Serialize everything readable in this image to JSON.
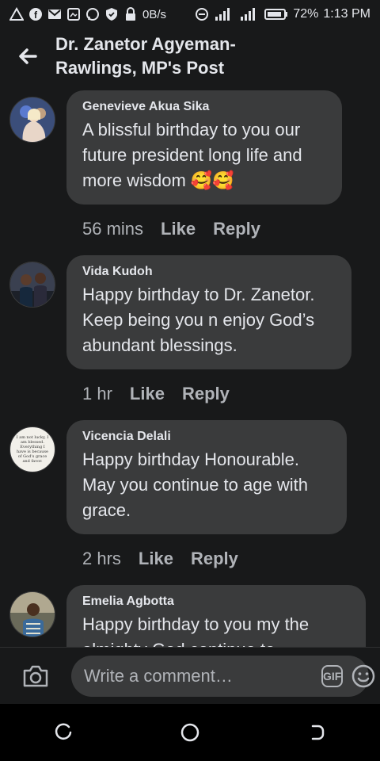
{
  "status_bar": {
    "data_speed": "0B/s",
    "battery": "72%",
    "time": "1:13 PM"
  },
  "header": {
    "title": "Dr. Zanetor Agyeman-Rawlings, MP's Post"
  },
  "comments": [
    {
      "author": "Genevieve Akua Sika",
      "text": "A blissful birthday to you our future president long life and more wisdom 🥰🥰",
      "time": "56 mins",
      "like": "Like",
      "reply": "Reply"
    },
    {
      "author": "Vida Kudoh",
      "text": "Happy birthday to Dr. Zanetor. Keep being you n enjoy God’s abundant blessings.",
      "time": "1 hr",
      "like": "Like",
      "reply": "Reply"
    },
    {
      "author": "Vicencia Delali",
      "text": "Happy birthday Honourable. May you continue to age with grace.",
      "time": "2 hrs",
      "like": "Like",
      "reply": "Reply",
      "avatar_text": "I am not lucky, I am blessed. Everything I have is because of God's grace and favor."
    },
    {
      "author": "Emelia Agbotta",
      "text": "Happy birthday to you my the almighty God continue to",
      "time": "",
      "like": "",
      "reply": ""
    }
  ],
  "composer": {
    "placeholder": "Write a comment…",
    "gif_label": "GIF"
  },
  "colors": {
    "background": "#18191a",
    "bubble": "#3a3b3c",
    "text_primary": "#e4e6eb",
    "text_secondary": "#b0b3b8"
  },
  "icons": {
    "back": "arrow-left-icon",
    "camera": "camera-icon",
    "emoji": "smiley-icon",
    "nav_recent": "recents-icon",
    "nav_home": "home-circle-icon",
    "nav_back": "back-icon"
  }
}
